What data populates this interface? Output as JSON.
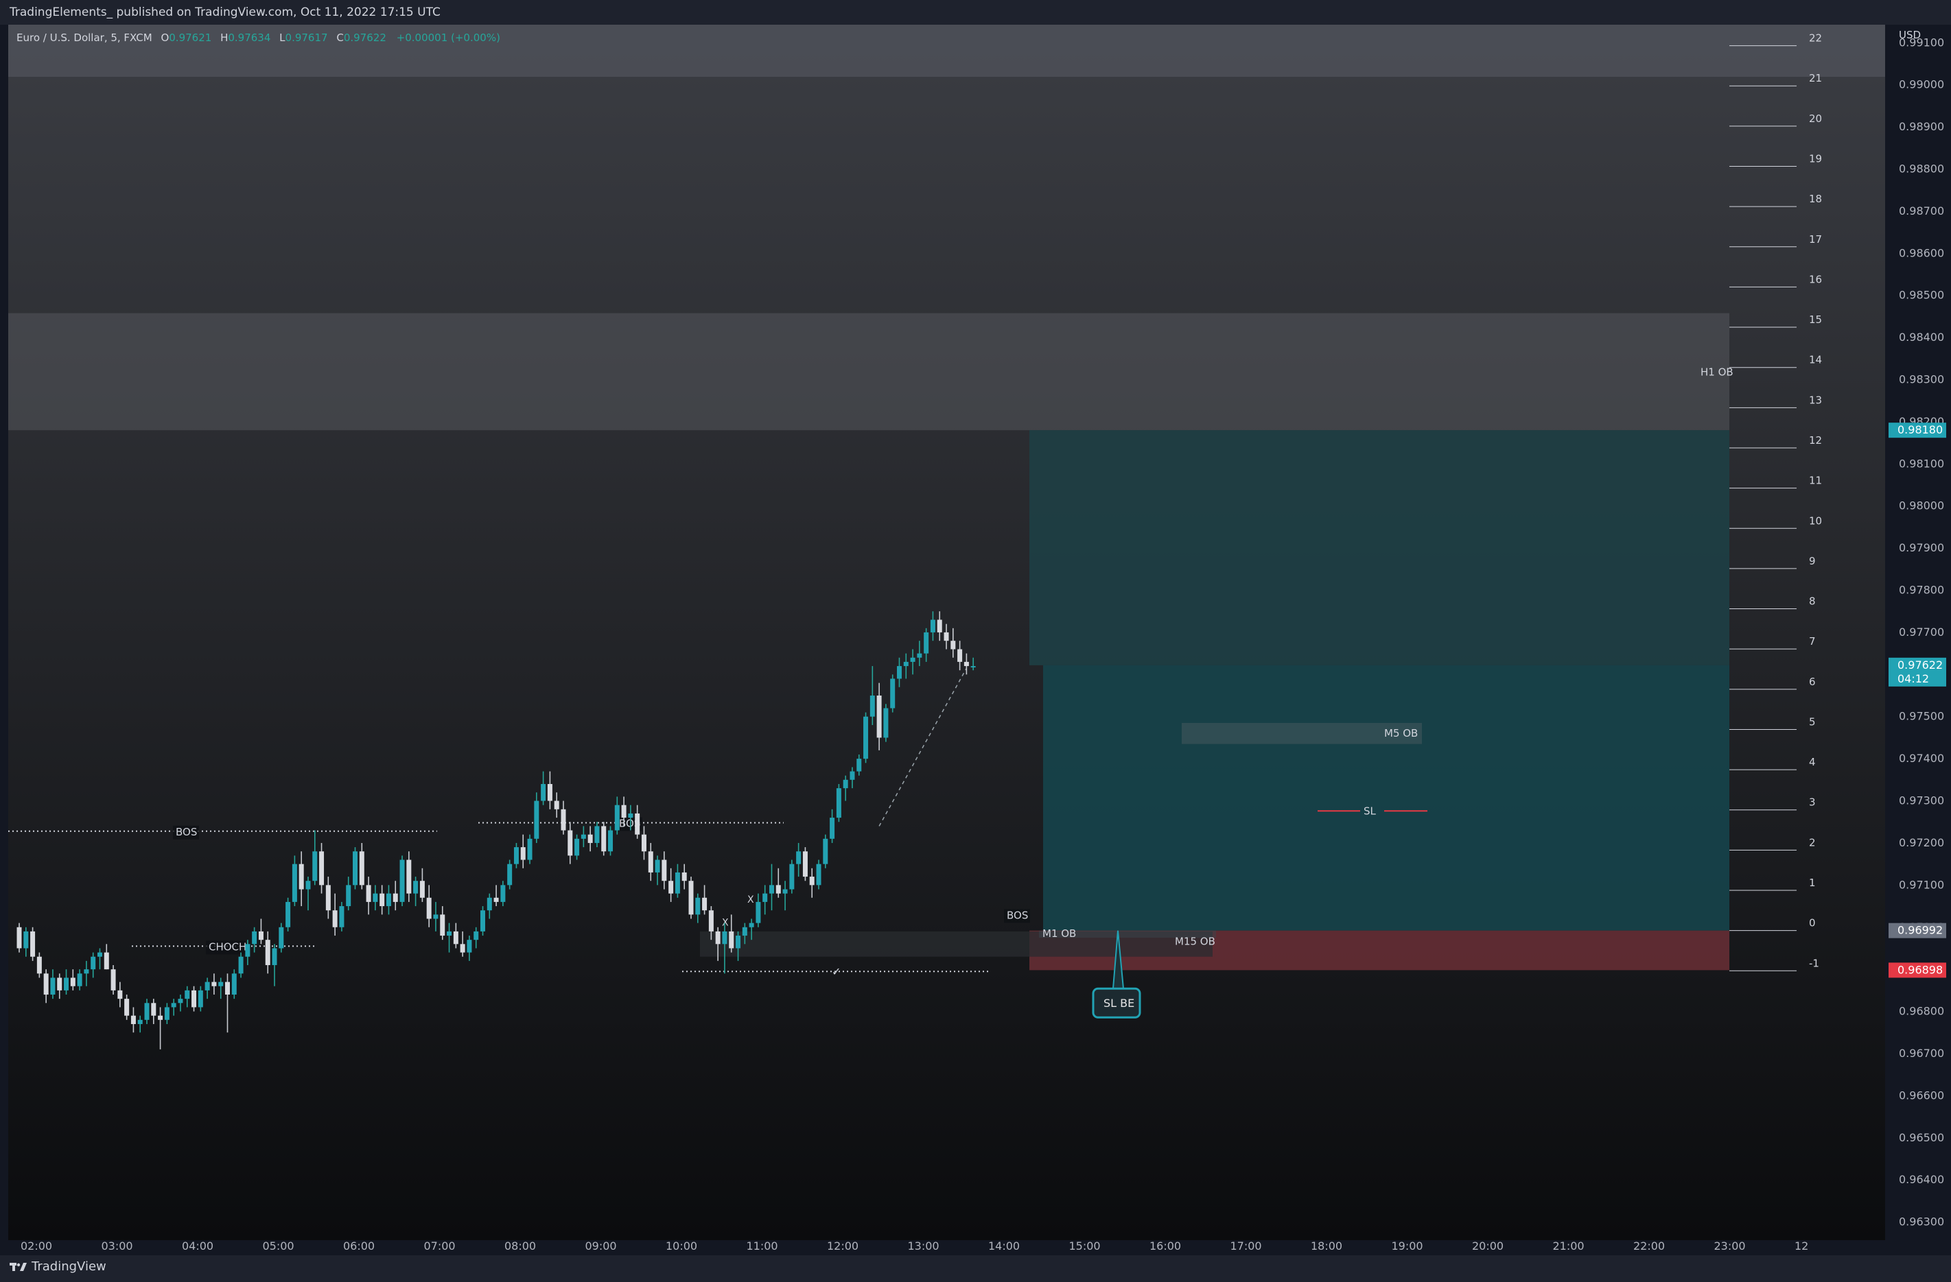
{
  "header": {
    "published": "TradingElements_ published on TradingView.com, Oct 11, 2022 17:15 UTC"
  },
  "legend": {
    "symbol": "Euro / U.S. Dollar, 5, FXCM",
    "open_label": "O",
    "open": "0.97621",
    "high_label": "H",
    "high": "0.97634",
    "low_label": "L",
    "low": "0.97617",
    "close_label": "C",
    "close": "0.97622",
    "change": "+0.00001 (+0.00%)"
  },
  "footer": {
    "brand": "TradingView"
  },
  "chart_data": {
    "type": "candlestick",
    "price_axis": {
      "currency": "USD",
      "ticks": [
        "0.99100",
        "0.99000",
        "0.98900",
        "0.98800",
        "0.98700",
        "0.98600",
        "0.98500",
        "0.98400",
        "0.98300",
        "0.98200",
        "0.98100",
        "0.98000",
        "0.97900",
        "0.97800",
        "0.97700",
        "0.97600",
        "0.97500",
        "0.97400",
        "0.97300",
        "0.97200",
        "0.97100",
        "0.97000",
        "0.96900",
        "0.96800",
        "0.96700",
        "0.96600",
        "0.96500",
        "0.96400",
        "0.96300"
      ],
      "range": [
        0.9627,
        0.9912
      ],
      "tags": [
        {
          "text": "0.98180",
          "value": 0.9818,
          "color": "#22a3b4"
        },
        {
          "text": "0.97622",
          "sub": "04:12",
          "value": 0.97622,
          "color": "#22a3b4"
        },
        {
          "text": "0.96992",
          "value": 0.96992,
          "color": "#6b7280"
        },
        {
          "text": "0.96898",
          "value": 0.96898,
          "color": "#e53945"
        }
      ]
    },
    "time_axis": {
      "labels": [
        "02:00",
        "03:00",
        "04:00",
        "05:00",
        "06:00",
        "07:00",
        "08:00",
        "09:00",
        "10:00",
        "11:00",
        "12:00",
        "13:00",
        "14:00",
        "15:00",
        "16:00",
        "17:00",
        "18:00",
        "19:00",
        "20:00",
        "21:00",
        "22:00",
        "23:00",
        "12"
      ]
    },
    "fib_levels": [
      "22",
      "21",
      "20",
      "19",
      "18",
      "17",
      "16",
      "15",
      "14",
      "13",
      "12",
      "11",
      "10",
      "9",
      "8",
      "7",
      "6",
      "5",
      "4",
      "3",
      "2",
      "1",
      "0",
      "-1"
    ],
    "fib_base": 0.96992,
    "fib_step": 0.000955,
    "zones": [
      {
        "label": "H1 OB",
        "top": 0.98458,
        "bottom": 0.9818
      },
      {
        "label": "M5 OB",
        "top": 0.97485,
        "bottom": 0.97435
      },
      {
        "label": "M15 OB",
        "top": 0.9699,
        "bottom": 0.9693
      },
      {
        "label": "M1 OB",
        "top": 0.96992,
        "bottom": 0.96975
      },
      {
        "label": "",
        "top": 0.9699,
        "bottom": 0.969
      }
    ],
    "annotations": [
      {
        "label": "BOS",
        "price": 0.97228
      },
      {
        "label": "BOS",
        "price": 0.97248
      },
      {
        "label": "CHOCH",
        "price": 0.96955
      },
      {
        "label": "SL",
        "price": 0.97276
      },
      {
        "label": "BOS",
        "price": 0.9703
      },
      {
        "label": "SL BE",
        "price": 0.96825
      },
      {
        "label": "X",
        "price": 0.97004
      },
      {
        "label": "X",
        "price": 0.97058
      },
      {
        "label": "✓",
        "price": 0.96895
      }
    ],
    "ohlc": [
      [
        0.97,
        0.9701,
        0.9694,
        0.9695
      ],
      [
        0.9695,
        0.97,
        0.9693,
        0.9699
      ],
      [
        0.9699,
        0.97,
        0.9692,
        0.9693
      ],
      [
        0.9693,
        0.9694,
        0.9688,
        0.9689
      ],
      [
        0.9689,
        0.969,
        0.9682,
        0.9684
      ],
      [
        0.9684,
        0.969,
        0.9683,
        0.9688
      ],
      [
        0.9688,
        0.9689,
        0.9683,
        0.9685
      ],
      [
        0.9685,
        0.969,
        0.9684,
        0.9688
      ],
      [
        0.9688,
        0.969,
        0.9685,
        0.9686
      ],
      [
        0.9686,
        0.969,
        0.9685,
        0.9689
      ],
      [
        0.9689,
        0.9692,
        0.9686,
        0.969
      ],
      [
        0.969,
        0.9694,
        0.9688,
        0.9693
      ],
      [
        0.9693,
        0.9695,
        0.969,
        0.9694
      ],
      [
        0.9694,
        0.9696,
        0.969,
        0.969
      ],
      [
        0.969,
        0.9691,
        0.9684,
        0.9685
      ],
      [
        0.9685,
        0.9687,
        0.9681,
        0.9683
      ],
      [
        0.9683,
        0.9684,
        0.9678,
        0.9679
      ],
      [
        0.9679,
        0.9681,
        0.9675,
        0.9677
      ],
      [
        0.9677,
        0.9679,
        0.9675,
        0.9678
      ],
      [
        0.9678,
        0.9683,
        0.9677,
        0.9682
      ],
      [
        0.9682,
        0.9683,
        0.9677,
        0.9679
      ],
      [
        0.9679,
        0.9681,
        0.9671,
        0.9678
      ],
      [
        0.9678,
        0.9682,
        0.9677,
        0.9681
      ],
      [
        0.9681,
        0.9683,
        0.9679,
        0.9682
      ],
      [
        0.9682,
        0.9684,
        0.968,
        0.9683
      ],
      [
        0.9683,
        0.9686,
        0.9681,
        0.9685
      ],
      [
        0.9685,
        0.9686,
        0.968,
        0.9681
      ],
      [
        0.9681,
        0.9686,
        0.968,
        0.9685
      ],
      [
        0.9685,
        0.9688,
        0.9683,
        0.9687
      ],
      [
        0.9687,
        0.9689,
        0.9684,
        0.9686
      ],
      [
        0.9686,
        0.9688,
        0.9683,
        0.9687
      ],
      [
        0.9687,
        0.9689,
        0.9675,
        0.9684
      ],
      [
        0.9684,
        0.969,
        0.9683,
        0.9689
      ],
      [
        0.9689,
        0.9694,
        0.9688,
        0.9693
      ],
      [
        0.9693,
        0.9697,
        0.9691,
        0.9696
      ],
      [
        0.9696,
        0.97,
        0.9694,
        0.9699
      ],
      [
        0.9699,
        0.9702,
        0.9696,
        0.9697
      ],
      [
        0.9697,
        0.9699,
        0.9689,
        0.9691
      ],
      [
        0.9691,
        0.9696,
        0.9686,
        0.9695
      ],
      [
        0.9695,
        0.9701,
        0.9694,
        0.97
      ],
      [
        0.97,
        0.9707,
        0.9699,
        0.9706
      ],
      [
        0.9706,
        0.9717,
        0.9705,
        0.9715
      ],
      [
        0.9715,
        0.9718,
        0.9705,
        0.9709
      ],
      [
        0.9709,
        0.9712,
        0.9704,
        0.9711
      ],
      [
        0.9711,
        0.9723,
        0.971,
        0.9718
      ],
      [
        0.9718,
        0.972,
        0.9708,
        0.971
      ],
      [
        0.971,
        0.9712,
        0.9702,
        0.9704
      ],
      [
        0.9704,
        0.9708,
        0.9698,
        0.97
      ],
      [
        0.97,
        0.9706,
        0.9699,
        0.9705
      ],
      [
        0.9705,
        0.9712,
        0.9704,
        0.971
      ],
      [
        0.971,
        0.9719,
        0.9709,
        0.9718
      ],
      [
        0.9718,
        0.972,
        0.9709,
        0.971
      ],
      [
        0.971,
        0.9712,
        0.9703,
        0.9706
      ],
      [
        0.9706,
        0.971,
        0.9704,
        0.9708
      ],
      [
        0.9708,
        0.971,
        0.9703,
        0.9705
      ],
      [
        0.9705,
        0.971,
        0.9703,
        0.9708
      ],
      [
        0.9708,
        0.9711,
        0.9704,
        0.9706
      ],
      [
        0.9706,
        0.9717,
        0.9705,
        0.9716
      ],
      [
        0.9716,
        0.9718,
        0.9706,
        0.9708
      ],
      [
        0.9708,
        0.9712,
        0.9705,
        0.9711
      ],
      [
        0.9711,
        0.9714,
        0.9706,
        0.9707
      ],
      [
        0.9707,
        0.971,
        0.97,
        0.9702
      ],
      [
        0.9702,
        0.9706,
        0.9699,
        0.9703
      ],
      [
        0.9703,
        0.9705,
        0.9697,
        0.9698
      ],
      [
        0.9698,
        0.9701,
        0.9694,
        0.9699
      ],
      [
        0.9699,
        0.9701,
        0.9695,
        0.9696
      ],
      [
        0.9696,
        0.9699,
        0.9693,
        0.9694
      ],
      [
        0.9694,
        0.9698,
        0.9692,
        0.9697
      ],
      [
        0.9697,
        0.97,
        0.9695,
        0.9699
      ],
      [
        0.9699,
        0.9705,
        0.9698,
        0.9704
      ],
      [
        0.9704,
        0.9708,
        0.9702,
        0.9707
      ],
      [
        0.9707,
        0.971,
        0.9705,
        0.9706
      ],
      [
        0.9706,
        0.9711,
        0.9705,
        0.971
      ],
      [
        0.971,
        0.9716,
        0.9709,
        0.9715
      ],
      [
        0.9715,
        0.972,
        0.9714,
        0.9719
      ],
      [
        0.9719,
        0.9722,
        0.9714,
        0.9716
      ],
      [
        0.9716,
        0.9722,
        0.9715,
        0.9721
      ],
      [
        0.9721,
        0.9732,
        0.972,
        0.973
      ],
      [
        0.973,
        0.9737,
        0.9729,
        0.9734
      ],
      [
        0.9734,
        0.9737,
        0.9728,
        0.973
      ],
      [
        0.973,
        0.9732,
        0.9726,
        0.9728
      ],
      [
        0.9728,
        0.973,
        0.9722,
        0.9723
      ],
      [
        0.9723,
        0.9725,
        0.9715,
        0.9717
      ],
      [
        0.9717,
        0.9722,
        0.9716,
        0.9721
      ],
      [
        0.9721,
        0.9724,
        0.9719,
        0.9722
      ],
      [
        0.9722,
        0.9724,
        0.9718,
        0.972
      ],
      [
        0.972,
        0.9725,
        0.9719,
        0.9724
      ],
      [
        0.9724,
        0.9725,
        0.9717,
        0.9718
      ],
      [
        0.9718,
        0.9724,
        0.9717,
        0.9723
      ],
      [
        0.9723,
        0.9731,
        0.9722,
        0.9729
      ],
      [
        0.9729,
        0.9731,
        0.9724,
        0.9726
      ],
      [
        0.9726,
        0.9729,
        0.9723,
        0.9727
      ],
      [
        0.9727,
        0.9729,
        0.9721,
        0.9722
      ],
      [
        0.9722,
        0.9724,
        0.9716,
        0.9718
      ],
      [
        0.9718,
        0.972,
        0.9711,
        0.9713
      ],
      [
        0.9713,
        0.9717,
        0.971,
        0.9716
      ],
      [
        0.9716,
        0.9718,
        0.9709,
        0.9711
      ],
      [
        0.9711,
        0.9714,
        0.9706,
        0.9708
      ],
      [
        0.9708,
        0.9715,
        0.9707,
        0.9713
      ],
      [
        0.9713,
        0.9715,
        0.9709,
        0.9711
      ],
      [
        0.9711,
        0.9712,
        0.9702,
        0.9703
      ],
      [
        0.9703,
        0.9708,
        0.9701,
        0.9707
      ],
      [
        0.9707,
        0.971,
        0.9703,
        0.9704
      ],
      [
        0.9704,
        0.9705,
        0.9697,
        0.9699
      ],
      [
        0.9699,
        0.97,
        0.9692,
        0.9696
      ],
      [
        0.9696,
        0.9701,
        0.9689,
        0.9699
      ],
      [
        0.9699,
        0.9703,
        0.9694,
        0.9695
      ],
      [
        0.9695,
        0.9699,
        0.9692,
        0.9698
      ],
      [
        0.9698,
        0.9701,
        0.9696,
        0.97
      ],
      [
        0.97,
        0.9702,
        0.9697,
        0.9701
      ],
      [
        0.9701,
        0.9708,
        0.97,
        0.9706
      ],
      [
        0.9706,
        0.971,
        0.9703,
        0.9708
      ],
      [
        0.9708,
        0.9715,
        0.9704,
        0.971
      ],
      [
        0.971,
        0.9714,
        0.9707,
        0.9708
      ],
      [
        0.9708,
        0.9711,
        0.9704,
        0.9709
      ],
      [
        0.9709,
        0.9716,
        0.9708,
        0.9715
      ],
      [
        0.9715,
        0.972,
        0.9712,
        0.9718
      ],
      [
        0.9718,
        0.9719,
        0.9711,
        0.9712
      ],
      [
        0.9712,
        0.9714,
        0.9707,
        0.971
      ],
      [
        0.971,
        0.9716,
        0.9709,
        0.9715
      ],
      [
        0.9715,
        0.9722,
        0.9714,
        0.9721
      ],
      [
        0.9721,
        0.9728,
        0.972,
        0.9726
      ],
      [
        0.9726,
        0.9734,
        0.9725,
        0.9733
      ],
      [
        0.9733,
        0.9736,
        0.973,
        0.9735
      ],
      [
        0.9735,
        0.9738,
        0.9733,
        0.9737
      ],
      [
        0.9737,
        0.9741,
        0.9736,
        0.974
      ],
      [
        0.974,
        0.9751,
        0.9739,
        0.975
      ],
      [
        0.975,
        0.9762,
        0.9748,
        0.9755
      ],
      [
        0.9755,
        0.9758,
        0.9742,
        0.9745
      ],
      [
        0.9745,
        0.9753,
        0.9744,
        0.9752
      ],
      [
        0.9752,
        0.976,
        0.9751,
        0.9759
      ],
      [
        0.9759,
        0.9764,
        0.9757,
        0.9762
      ],
      [
        0.9762,
        0.9765,
        0.9759,
        0.9763
      ],
      [
        0.9763,
        0.9766,
        0.976,
        0.9764
      ],
      [
        0.9764,
        0.9768,
        0.9762,
        0.9765
      ],
      [
        0.9765,
        0.9771,
        0.9763,
        0.977
      ],
      [
        0.977,
        0.9775,
        0.9768,
        0.9773
      ],
      [
        0.9773,
        0.9775,
        0.9768,
        0.977
      ],
      [
        0.977,
        0.9772,
        0.9766,
        0.9768
      ],
      [
        0.9768,
        0.9771,
        0.9764,
        0.9766
      ],
      [
        0.9766,
        0.9768,
        0.9761,
        0.9763
      ],
      [
        0.9763,
        0.9765,
        0.976,
        0.9762
      ],
      [
        0.9762,
        0.9764,
        0.9761,
        0.9762
      ]
    ]
  }
}
